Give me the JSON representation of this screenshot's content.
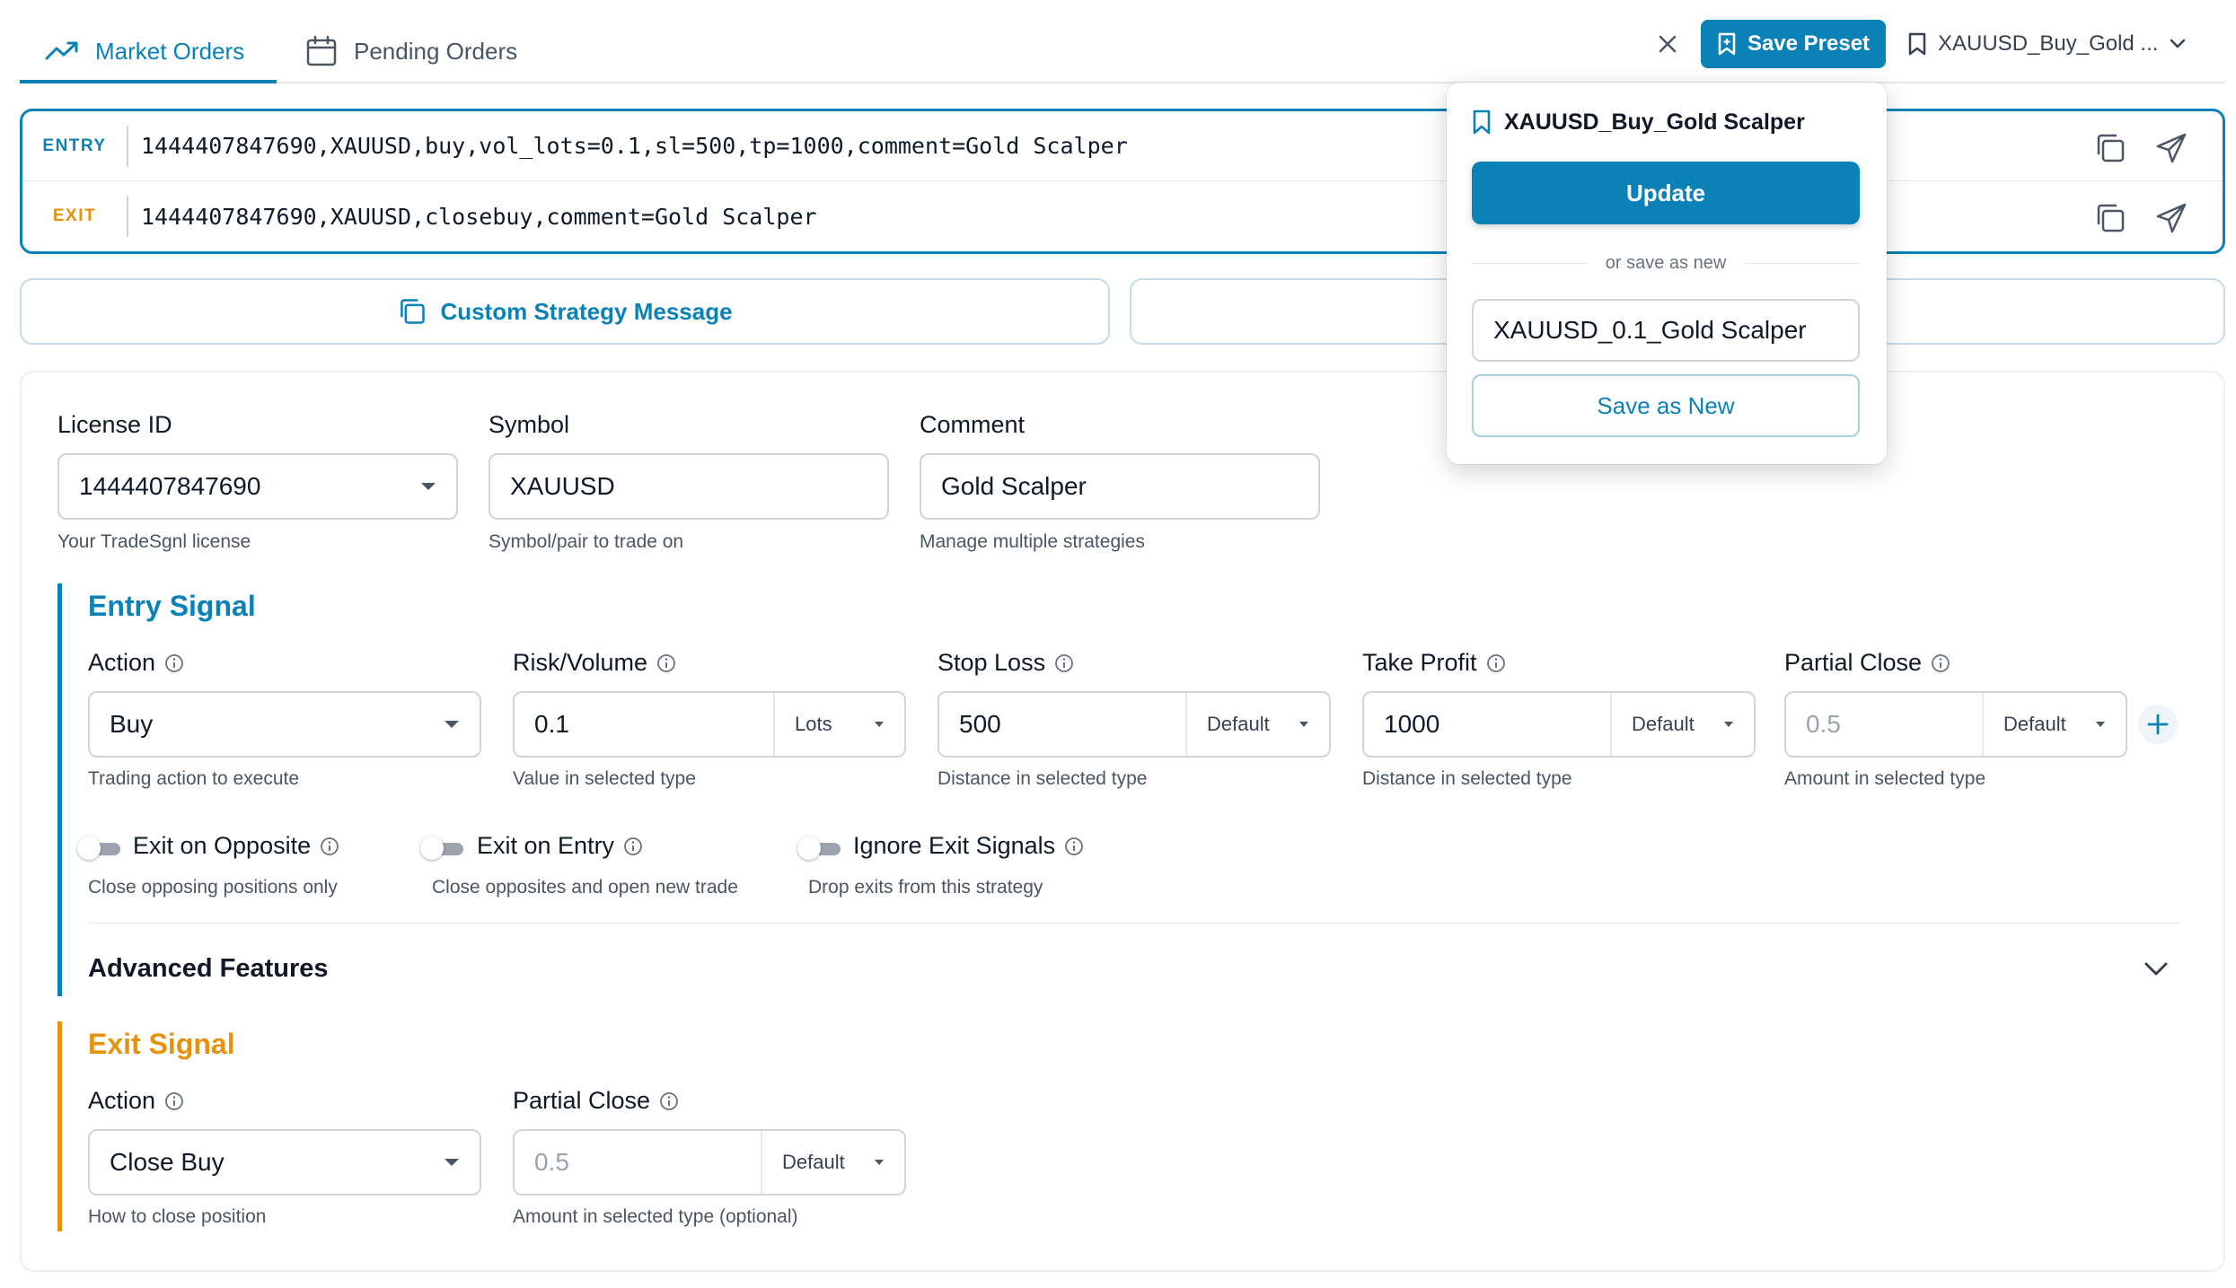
{
  "tabs": {
    "market_orders": "Market Orders",
    "pending_orders": "Pending Orders"
  },
  "header": {
    "save_preset_label": "Save Preset",
    "preset_name": "XAUUSD_Buy_Gold ..."
  },
  "messages": {
    "entry": {
      "tag": "ENTRY",
      "text": "1444407847690,XAUUSD,buy,vol_lots=0.1,sl=500,tp=1000,comment=Gold Scalper"
    },
    "exit": {
      "tag": "EXIT",
      "text": "1444407847690,XAUUSD,closebuy,comment=Gold Scalper"
    }
  },
  "custom_strategy_label": "Custom Strategy Message",
  "general": {
    "license": {
      "label": "License ID",
      "value": "1444407847690",
      "help": "Your TradeSgnl license"
    },
    "symbol": {
      "label": "Symbol",
      "value": "XAUUSD",
      "help": "Symbol/pair to trade on"
    },
    "comment": {
      "label": "Comment",
      "value": "Gold Scalper",
      "help": "Manage multiple strategies"
    }
  },
  "entry_signal": {
    "title": "Entry Signal",
    "action": {
      "label": "Action",
      "value": "Buy",
      "help": "Trading action to execute"
    },
    "risk": {
      "label": "Risk/Volume",
      "value": "0.1",
      "unit": "Lots",
      "help": "Value in selected type"
    },
    "stop_loss": {
      "label": "Stop Loss",
      "value": "500",
      "unit": "Default",
      "help": "Distance in selected type"
    },
    "take_profit": {
      "label": "Take Profit",
      "value": "1000",
      "unit": "Default",
      "help": "Distance in selected type"
    },
    "partial_close": {
      "label": "Partial Close",
      "placeholder": "0.5",
      "unit": "Default",
      "help": "Amount in selected type"
    },
    "toggles": [
      {
        "label": "Exit on Opposite",
        "help": "Close opposing positions only"
      },
      {
        "label": "Exit on Entry",
        "help": "Close opposites and open new trade"
      },
      {
        "label": "Ignore Exit Signals",
        "help": "Drop exits from this strategy"
      }
    ],
    "advanced_label": "Advanced Features"
  },
  "exit_signal": {
    "title": "Exit Signal",
    "action": {
      "label": "Action",
      "value": "Close Buy",
      "help": "How to close position"
    },
    "partial_close": {
      "label": "Partial Close",
      "placeholder": "0.5",
      "unit": "Default",
      "help": "Amount in selected type (optional)"
    }
  },
  "popup": {
    "title": "XAUUSD_Buy_Gold Scalper",
    "update_label": "Update",
    "or_label": "or save as new",
    "new_name_value": "XAUUSD_0.1_Gold Scalper",
    "save_new_label": "Save as New"
  },
  "colors": {
    "accent": "#0a82b8",
    "entry": "#0a82b8",
    "exit": "#e7920e"
  },
  "icons": [
    "trending-up-icon",
    "calendar-icon",
    "close-icon",
    "bookmark-icon",
    "chevron-down-icon",
    "copy-icon",
    "send-icon",
    "info-icon",
    "plus-icon"
  ]
}
